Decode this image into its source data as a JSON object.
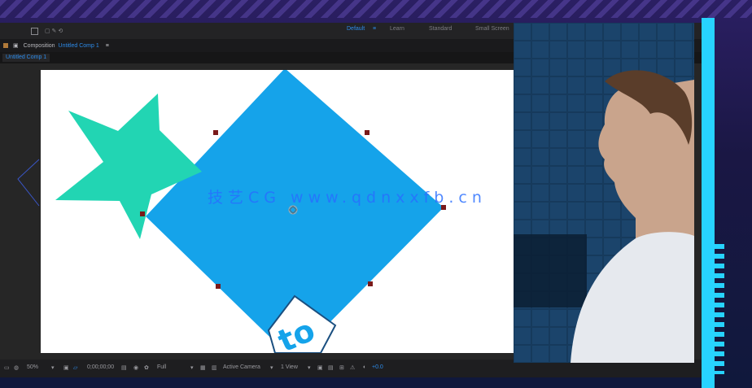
{
  "app": {
    "workspace_tabs": [
      "Default",
      "Learn",
      "Standard",
      "Small Screen"
    ],
    "active_workspace": "Default",
    "panel_title": "Composition",
    "comp_name": "Untitled Comp 1",
    "tab_label": "Untitled Comp 1"
  },
  "bottom_bar": {
    "zoom": "50%",
    "timecode": "0;00;00;00",
    "resolution": "Full",
    "camera": "Active Camera",
    "views": "1 View",
    "exposure": "+0.0"
  },
  "canvas": {
    "layer_text": "to"
  },
  "watermark": {
    "text": "技艺CG www.qdnxxfb.cn"
  },
  "colors": {
    "diamond": "#15a3ea",
    "star": "#22d5b3",
    "accent": "#2d8ceb",
    "handle": "#7a1a1a"
  }
}
